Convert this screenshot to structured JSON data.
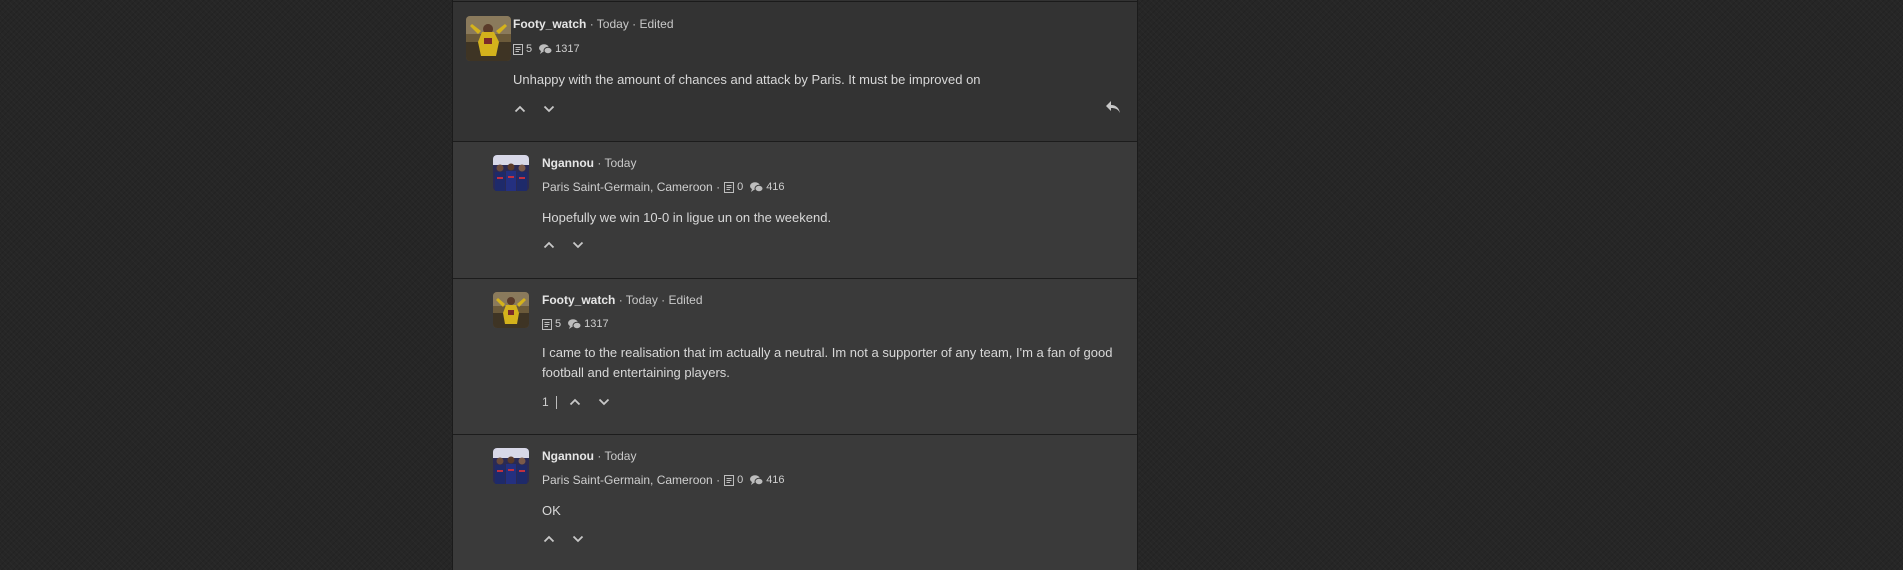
{
  "comments": [
    {
      "username": "Footy_watch",
      "meta": "· Today · Edited",
      "affiliation": "",
      "stat_posts": "5",
      "stat_comments": "1317",
      "body": "Unhappy with the amount of chances and attack by Paris. It must be improved on",
      "vote_count": "",
      "avatar_icon": "player-red-kit-avatar",
      "has_reply_button": true
    },
    {
      "username": "Ngannou",
      "meta": "· Today",
      "affiliation": "Paris Saint-Germain, Cameroon ·",
      "stat_posts": "0",
      "stat_comments": "416",
      "body": "Hopefully we win 10-0 in ligue un on the weekend.",
      "vote_count": "",
      "avatar_icon": "team-players-avatar"
    },
    {
      "username": "Footy_watch",
      "meta": "· Today · Edited",
      "affiliation": "",
      "stat_posts": "5",
      "stat_comments": "1317",
      "body": "I came to the realisation that im actually a neutral. Im not a supporter of any team, I'm a fan of good football and entertaining players.",
      "vote_count": "1",
      "avatar_icon": "player-red-kit-avatar"
    },
    {
      "username": "Ngannou",
      "meta": "· Today",
      "affiliation": "Paris Saint-Germain, Cameroon ·",
      "stat_posts": "0",
      "stat_comments": "416",
      "body": "OK",
      "vote_count": "",
      "avatar_icon": "team-players-avatar"
    }
  ],
  "colors": {
    "page_bg": "#262626",
    "thread_bg": "#333333",
    "reply_bg": "#3a3a3a",
    "text": "#d8d8d8"
  }
}
